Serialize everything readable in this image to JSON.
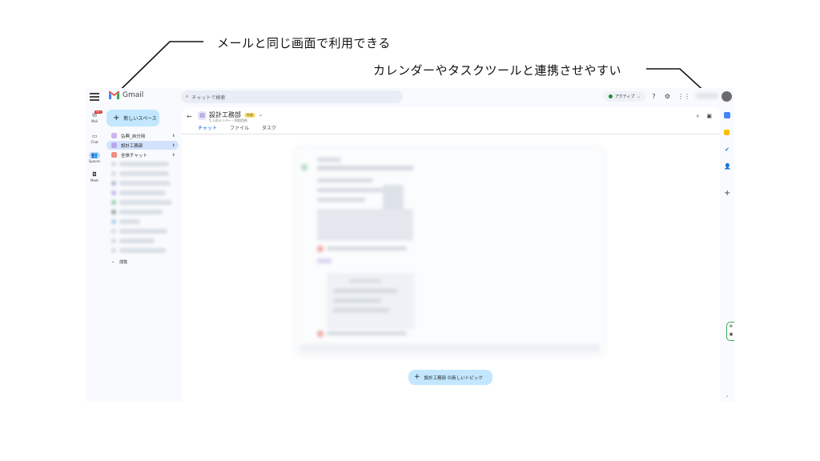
{
  "annotations": {
    "top": "メールと同じ画面で利用できる",
    "right": "カレンダーやタスクツールと連携させやすい"
  },
  "app": {
    "name": "Gmail",
    "search_placeholder": "チャットで検索",
    "status": "アクティブ",
    "rail": [
      {
        "label": "Mail",
        "badge": "99+"
      },
      {
        "label": "Chat"
      },
      {
        "label": "Spaces"
      },
      {
        "label": "Meet"
      }
    ],
    "new_space": "新しいスペース",
    "spaces": [
      {
        "label": "弘興_自分用",
        "color": "#c8b6f0"
      },
      {
        "label": "設計工務部",
        "color": "#b9a6ee"
      },
      {
        "label": "全体チャット",
        "color": "#f28b82"
      }
    ],
    "section": "閲覧",
    "room": {
      "title": "設計工務部",
      "badge": "外部",
      "subtitle": "5 人のメンバー・利用目的",
      "tabs": [
        "チャット",
        "ファイル",
        "タスク"
      ]
    },
    "new_topic": "設計工務部 の新しいトピック"
  },
  "colors": {
    "accent": "#0b57d0",
    "button_bg": "#c2e7ff",
    "active_bg": "#d3e3fd",
    "sidebar_bg": "#f8fafd"
  }
}
